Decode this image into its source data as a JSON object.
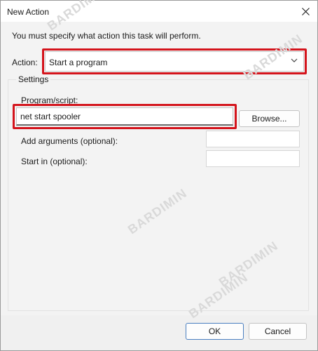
{
  "window": {
    "title": "New Action"
  },
  "instruction": "You must specify what action this task will perform.",
  "action": {
    "label": "Action:",
    "selected": "Start a program"
  },
  "settings": {
    "legend": "Settings",
    "program_label": "Program/script:",
    "program_value": "net start spooler",
    "browse_label": "Browse...",
    "args_label": "Add arguments (optional):",
    "args_value": "",
    "startin_label": "Start in (optional):",
    "startin_value": ""
  },
  "buttons": {
    "ok": "OK",
    "cancel": "Cancel"
  },
  "watermark": "BARDIMIN",
  "colors": {
    "highlight": "#d4141c",
    "primary_border": "#4a7fc0"
  }
}
